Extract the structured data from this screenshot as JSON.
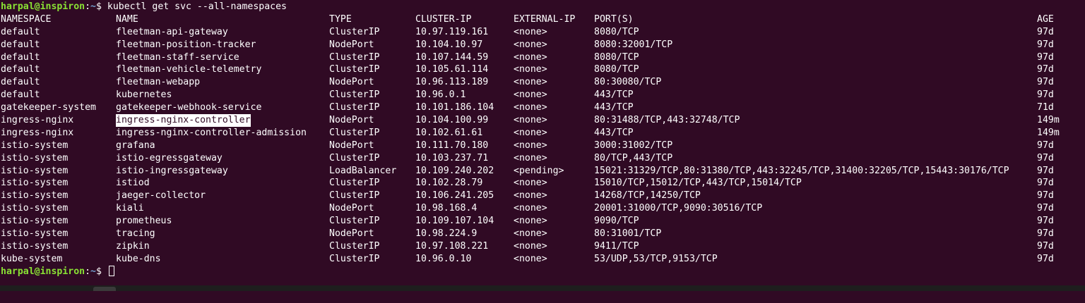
{
  "prompt": {
    "user_host": "harpal@inspiron",
    "sep": ":",
    "path": "~",
    "symbol": "$ ",
    "command": "kubectl get svc --all-namespaces"
  },
  "headers": {
    "namespace": "NAMESPACE",
    "name": "NAME",
    "type": "TYPE",
    "cluster_ip": "CLUSTER-IP",
    "external_ip": "EXTERNAL-IP",
    "ports": "PORT(S)",
    "age": "AGE"
  },
  "rows": [
    {
      "ns": "default",
      "name": "fleetman-api-gateway",
      "type": "ClusterIP",
      "ip": "10.97.119.161",
      "ext": "<none>",
      "ports": "8080/TCP",
      "age": "97d"
    },
    {
      "ns": "default",
      "name": "fleetman-position-tracker",
      "type": "NodePort",
      "ip": "10.104.10.97",
      "ext": "<none>",
      "ports": "8080:32001/TCP",
      "age": "97d"
    },
    {
      "ns": "default",
      "name": "fleetman-staff-service",
      "type": "ClusterIP",
      "ip": "10.107.144.59",
      "ext": "<none>",
      "ports": "8080/TCP",
      "age": "97d"
    },
    {
      "ns": "default",
      "name": "fleetman-vehicle-telemetry",
      "type": "ClusterIP",
      "ip": "10.105.61.114",
      "ext": "<none>",
      "ports": "8080/TCP",
      "age": "97d"
    },
    {
      "ns": "default",
      "name": "fleetman-webapp",
      "type": "NodePort",
      "ip": "10.96.113.189",
      "ext": "<none>",
      "ports": "80:30080/TCP",
      "age": "97d"
    },
    {
      "ns": "default",
      "name": "kubernetes",
      "type": "ClusterIP",
      "ip": "10.96.0.1",
      "ext": "<none>",
      "ports": "443/TCP",
      "age": "97d"
    },
    {
      "ns": "gatekeeper-system",
      "name": "gatekeeper-webhook-service",
      "type": "ClusterIP",
      "ip": "10.101.186.104",
      "ext": "<none>",
      "ports": "443/TCP",
      "age": "71d"
    },
    {
      "ns": "ingress-nginx",
      "name": "ingress-nginx-controller",
      "type": "NodePort",
      "ip": "10.104.100.99",
      "ext": "<none>",
      "ports": "80:31488/TCP,443:32748/TCP",
      "age": "149m",
      "selected": true
    },
    {
      "ns": "ingress-nginx",
      "name": "ingress-nginx-controller-admission",
      "type": "ClusterIP",
      "ip": "10.102.61.61",
      "ext": "<none>",
      "ports": "443/TCP",
      "age": "149m"
    },
    {
      "ns": "istio-system",
      "name": "grafana",
      "type": "NodePort",
      "ip": "10.111.70.180",
      "ext": "<none>",
      "ports": "3000:31002/TCP",
      "age": "97d"
    },
    {
      "ns": "istio-system",
      "name": "istio-egressgateway",
      "type": "ClusterIP",
      "ip": "10.103.237.71",
      "ext": "<none>",
      "ports": "80/TCP,443/TCP",
      "age": "97d"
    },
    {
      "ns": "istio-system",
      "name": "istio-ingressgateway",
      "type": "LoadBalancer",
      "ip": "10.109.240.202",
      "ext": "<pending>",
      "ports": "15021:31329/TCP,80:31380/TCP,443:32245/TCP,31400:32205/TCP,15443:30176/TCP",
      "age": "97d"
    },
    {
      "ns": "istio-system",
      "name": "istiod",
      "type": "ClusterIP",
      "ip": "10.102.28.79",
      "ext": "<none>",
      "ports": "15010/TCP,15012/TCP,443/TCP,15014/TCP",
      "age": "97d"
    },
    {
      "ns": "istio-system",
      "name": "jaeger-collector",
      "type": "ClusterIP",
      "ip": "10.106.241.205",
      "ext": "<none>",
      "ports": "14268/TCP,14250/TCP",
      "age": "97d"
    },
    {
      "ns": "istio-system",
      "name": "kiali",
      "type": "NodePort",
      "ip": "10.98.168.4",
      "ext": "<none>",
      "ports": "20001:31000/TCP,9090:30516/TCP",
      "age": "97d"
    },
    {
      "ns": "istio-system",
      "name": "prometheus",
      "type": "ClusterIP",
      "ip": "10.109.107.104",
      "ext": "<none>",
      "ports": "9090/TCP",
      "age": "97d"
    },
    {
      "ns": "istio-system",
      "name": "tracing",
      "type": "NodePort",
      "ip": "10.98.224.9",
      "ext": "<none>",
      "ports": "80:31001/TCP",
      "age": "97d"
    },
    {
      "ns": "istio-system",
      "name": "zipkin",
      "type": "ClusterIP",
      "ip": "10.97.108.221",
      "ext": "<none>",
      "ports": "9411/TCP",
      "age": "97d"
    },
    {
      "ns": "kube-system",
      "name": "kube-dns",
      "type": "ClusterIP",
      "ip": "10.96.0.10",
      "ext": "<none>",
      "ports": "53/UDP,53/TCP,9153/TCP",
      "age": "97d"
    }
  ],
  "colors": {
    "background": "#300a24",
    "prompt_user": "#8ae234",
    "prompt_path": "#729fcf",
    "text": "#ffffff"
  }
}
